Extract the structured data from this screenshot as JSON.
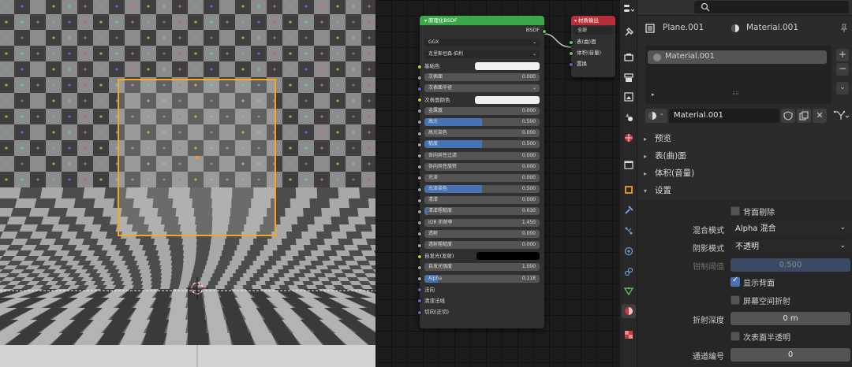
{
  "node_editor": {
    "bsdf_node": {
      "title": "原理化BSDF",
      "output_label": "BSDF",
      "distribution": "GGX",
      "subsurface_method": "克里斯坦森-伯利",
      "base_color_label": "基础色",
      "subsurface_label": "次表面",
      "subsurface_value": "0.000",
      "subsurface_radius_label": "次表面半径",
      "subsurface_color_label": "次表面颜色",
      "metallic_label": "金属度",
      "metallic_value": "0.000",
      "specular_label": "高光",
      "specular_value": "0.500",
      "specular_fraction": 0.5,
      "specular_tint_label": "高光染色",
      "specular_tint_value": "0.000",
      "roughness_label": "糙度",
      "roughness_value": "0.500",
      "roughness_fraction": 0.5,
      "anisotropic_label": "各向异性过滤",
      "anisotropic_value": "0.000",
      "anisotropic_rotation_label": "各向异性旋转",
      "anisotropic_rotation_value": "0.000",
      "sheen_label": "光泽",
      "sheen_value": "0.000",
      "sheen_tint_label": "光泽染色",
      "sheen_tint_value": "0.500",
      "sheen_tint_fraction": 0.5,
      "clearcoat_label": "清漆",
      "clearcoat_value": "0.000",
      "clearcoat_roughness_label": "清漆粗糙度",
      "clearcoat_roughness_value": "0.030",
      "clearcoat_roughness_fraction": 0.03,
      "ior_label": "IOR 折射率",
      "ior_value": "1.450",
      "transmission_label": "透射",
      "transmission_value": "0.000",
      "transmission_roughness_label": "透射粗糙度",
      "transmission_roughness_value": "0.000",
      "emission_label": "自发光(发射)",
      "emission_strength_label": "自发光强度",
      "emission_strength_value": "1.000",
      "alpha_label": "Alpha",
      "alpha_value": "0.118",
      "alpha_fraction": 0.118,
      "normal_label": "法向",
      "clearcoat_normal_label": "清漆法线",
      "tangent_label": "切向(正切)"
    },
    "output_node": {
      "title": "材质输出",
      "target": "全部",
      "surface_label": "表(曲)面",
      "volume_label": "体积(音量)",
      "displacement_label": "置换"
    }
  },
  "properties": {
    "object_name": "Plane.001",
    "material_name": "Material.001",
    "slot_name": "Material.001",
    "datablock_name": "Material.001",
    "sections": {
      "preview": "预览",
      "surface": "表(曲)面",
      "volume": "体积(音量)",
      "settings": "设置"
    },
    "backface_culling_label": "背面剔除",
    "blend_mode_label": "混合模式",
    "blend_mode_value": "Alpha 混合",
    "shadow_mode_label": "阴影模式",
    "shadow_mode_value": "不透明",
    "clip_threshold_label": "钳制阈值",
    "clip_threshold_value": "0.500",
    "show_backface_label": "显示背面",
    "screen_refraction_label": "屏幕空间折射",
    "refraction_depth_label": "折射深度",
    "refraction_depth_value": "0 m",
    "subsurface_translucency_label": "次表面半透明",
    "pass_index_label": "通道编号",
    "pass_index_value": "0"
  },
  "colors": {
    "bsdf_header": "#3ba64a",
    "output_header": "#b5303a",
    "selection_outline": "#f5a623",
    "active_tab": "#3d3d3d",
    "accent_blue": "#4772b3",
    "socket_yellow": "#c7c729",
    "socket_purple": "#6363c7",
    "socket_green": "#63c763"
  },
  "icons": [
    "editor-type-icon",
    "search-icon",
    "tool-icon",
    "render-icon",
    "output-icon",
    "view-layer-icon",
    "scene-icon",
    "world-icon",
    "collection-icon",
    "object-icon",
    "modifier-icon",
    "particles-icon",
    "physics-icon",
    "constraints-icon",
    "data-icon",
    "material-icon",
    "texture-icon",
    "pin-icon",
    "plus-icon",
    "minus-icon",
    "sphere-icon",
    "shield-icon",
    "copy-icon",
    "close-icon",
    "node-tree-icon"
  ]
}
